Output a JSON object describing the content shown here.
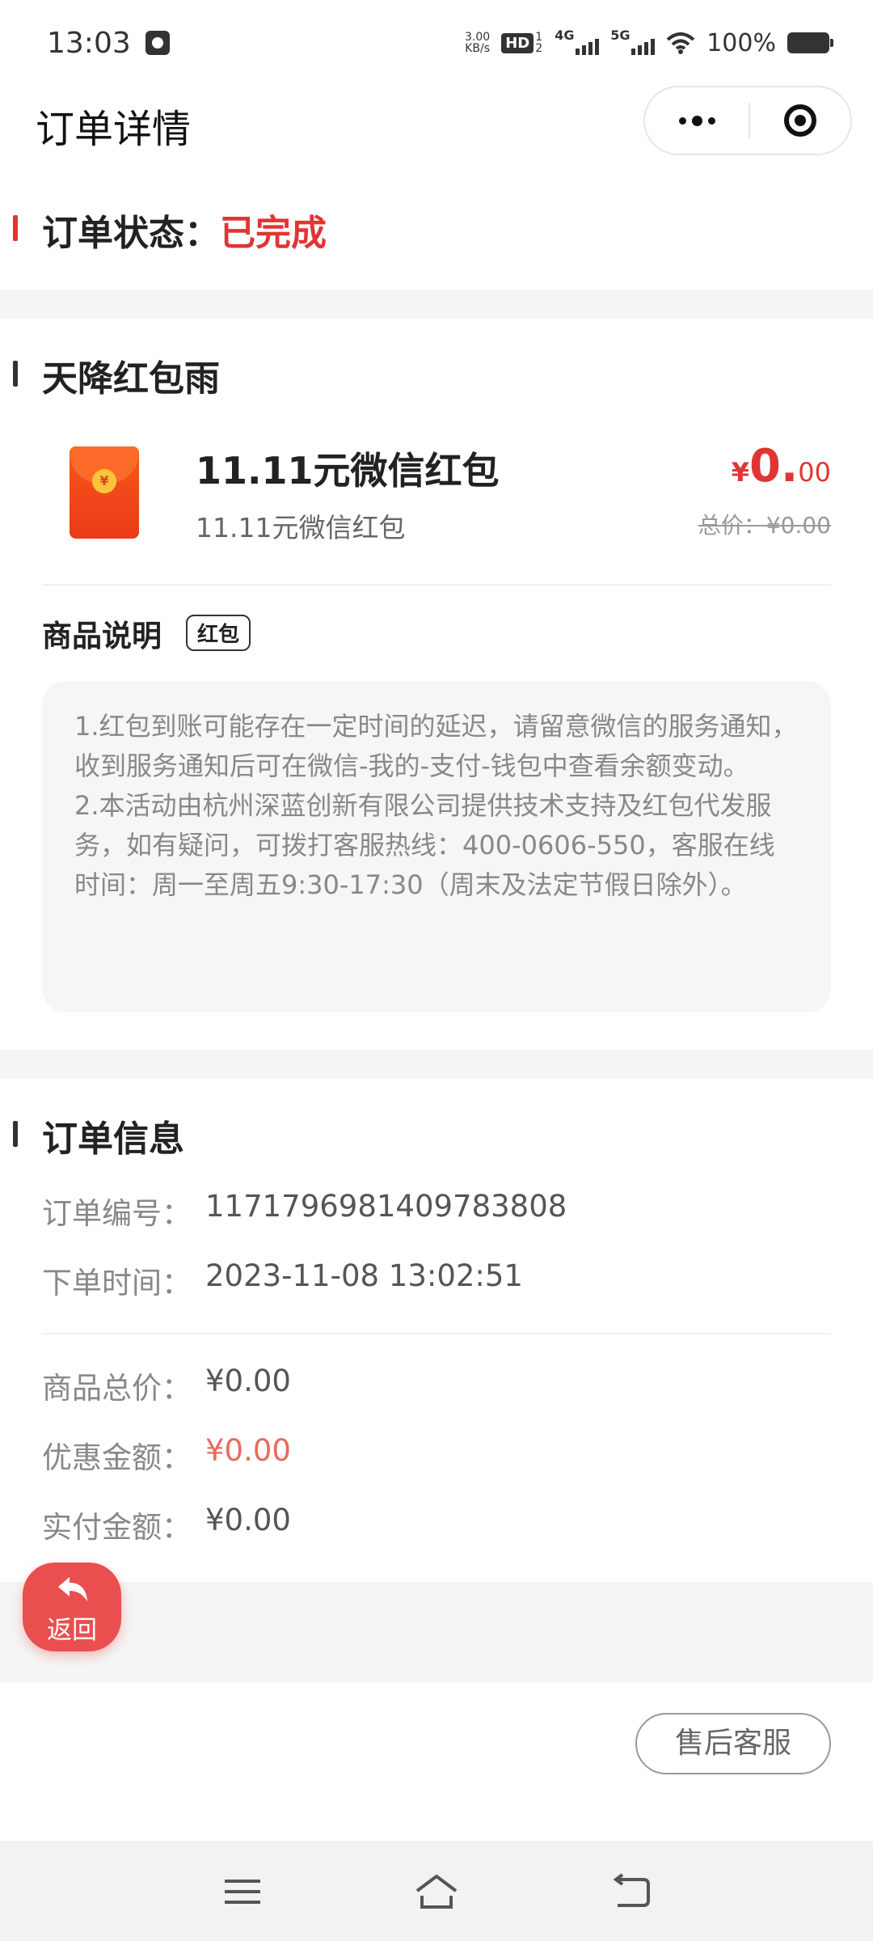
{
  "status_bar": {
    "time": "13:03",
    "net_speed_value": "3.00",
    "net_speed_unit": "KB/s",
    "hd_label": "HD",
    "hd_sub": "1 2",
    "sim1_label": "4G",
    "sim2_label": "5G",
    "battery": "100%"
  },
  "header": {
    "title": "订单详情"
  },
  "order_status": {
    "label": "订单状态：",
    "value": "已完成"
  },
  "product_section": {
    "title": "天降红包雨",
    "product_name": "11.11元微信红包",
    "product_sub": "11.11元微信红包",
    "price_currency": "¥",
    "price_int": "0.",
    "price_dec": "00",
    "total_price": "总价：¥0.00",
    "coin_symbol": "¥"
  },
  "description": {
    "title": "商品说明",
    "tag": "红包",
    "para1": "1.红包到账可能存在一定时间的延迟，请留意微信的服务通知，收到服务通知后可在微信-我的-支付-钱包中查看余额变动。",
    "para2": "2.本活动由杭州深蓝创新有限公司提供技术支持及红包代发服务，如有疑问，可拨打客服热线：400-0606-550，客服在线时间：周一至周五9:30-17:30（周末及法定节假日除外）。"
  },
  "order_info": {
    "title": "订单信息",
    "order_no_label": "订单编号：",
    "order_no": "1171796981409783808",
    "order_time_label": "下单时间：",
    "order_time": "2023-11-08 13:02:51",
    "goods_total_label": "商品总价：",
    "goods_total": "¥0.00",
    "discount_label": "优惠金额：",
    "discount": "¥0.00",
    "paid_label": "实付金额：",
    "paid": "¥0.00"
  },
  "actions": {
    "back_label": "返回",
    "after_sale_label": "售后客服"
  },
  "colors": {
    "accent_red": "#e03535",
    "back_button": "#ea4f4f",
    "gray_band": "#f5f5f5"
  },
  "icons": {
    "more": "more-dots-icon",
    "close": "close-miniprogram-icon",
    "back": "back-arrow-icon",
    "nav_menu": "menu-icon",
    "nav_home": "home-icon",
    "nav_back": "nav-back-icon"
  }
}
